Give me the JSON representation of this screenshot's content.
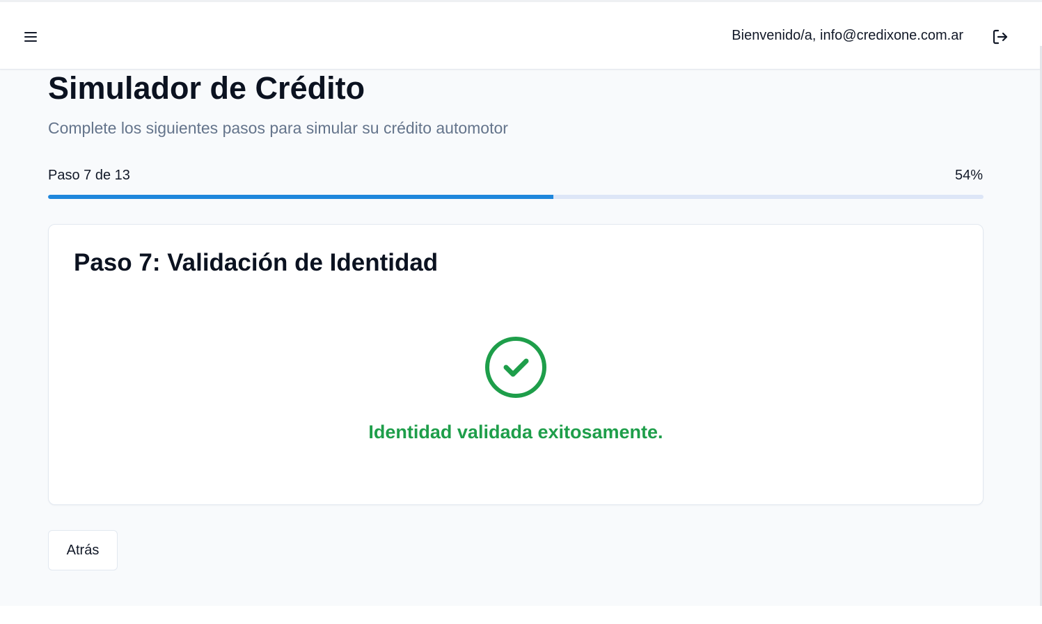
{
  "header": {
    "menu_icon": "hamburger-menu-icon",
    "welcome_text": "Bienvenido/a, info@credixone.com.ar",
    "logout_icon": "logout-icon"
  },
  "page": {
    "title": "Simulador de Crédito",
    "subtitle": "Complete los siguientes pasos para simular su crédito automotor"
  },
  "progress": {
    "step_label": "Paso 7 de 13",
    "percent_label": "54%",
    "percent_value": 54
  },
  "card": {
    "title": "Paso 7: Validación de Identidad",
    "status_icon": "check-circle-icon",
    "status_message": "Identidad validada exitosamente."
  },
  "actions": {
    "back_label": "Atrás"
  },
  "colors": {
    "progress_fill": "#1f87dc",
    "progress_track": "#dde6f7",
    "success": "#1e9e4a",
    "background": "#f8fafc"
  }
}
